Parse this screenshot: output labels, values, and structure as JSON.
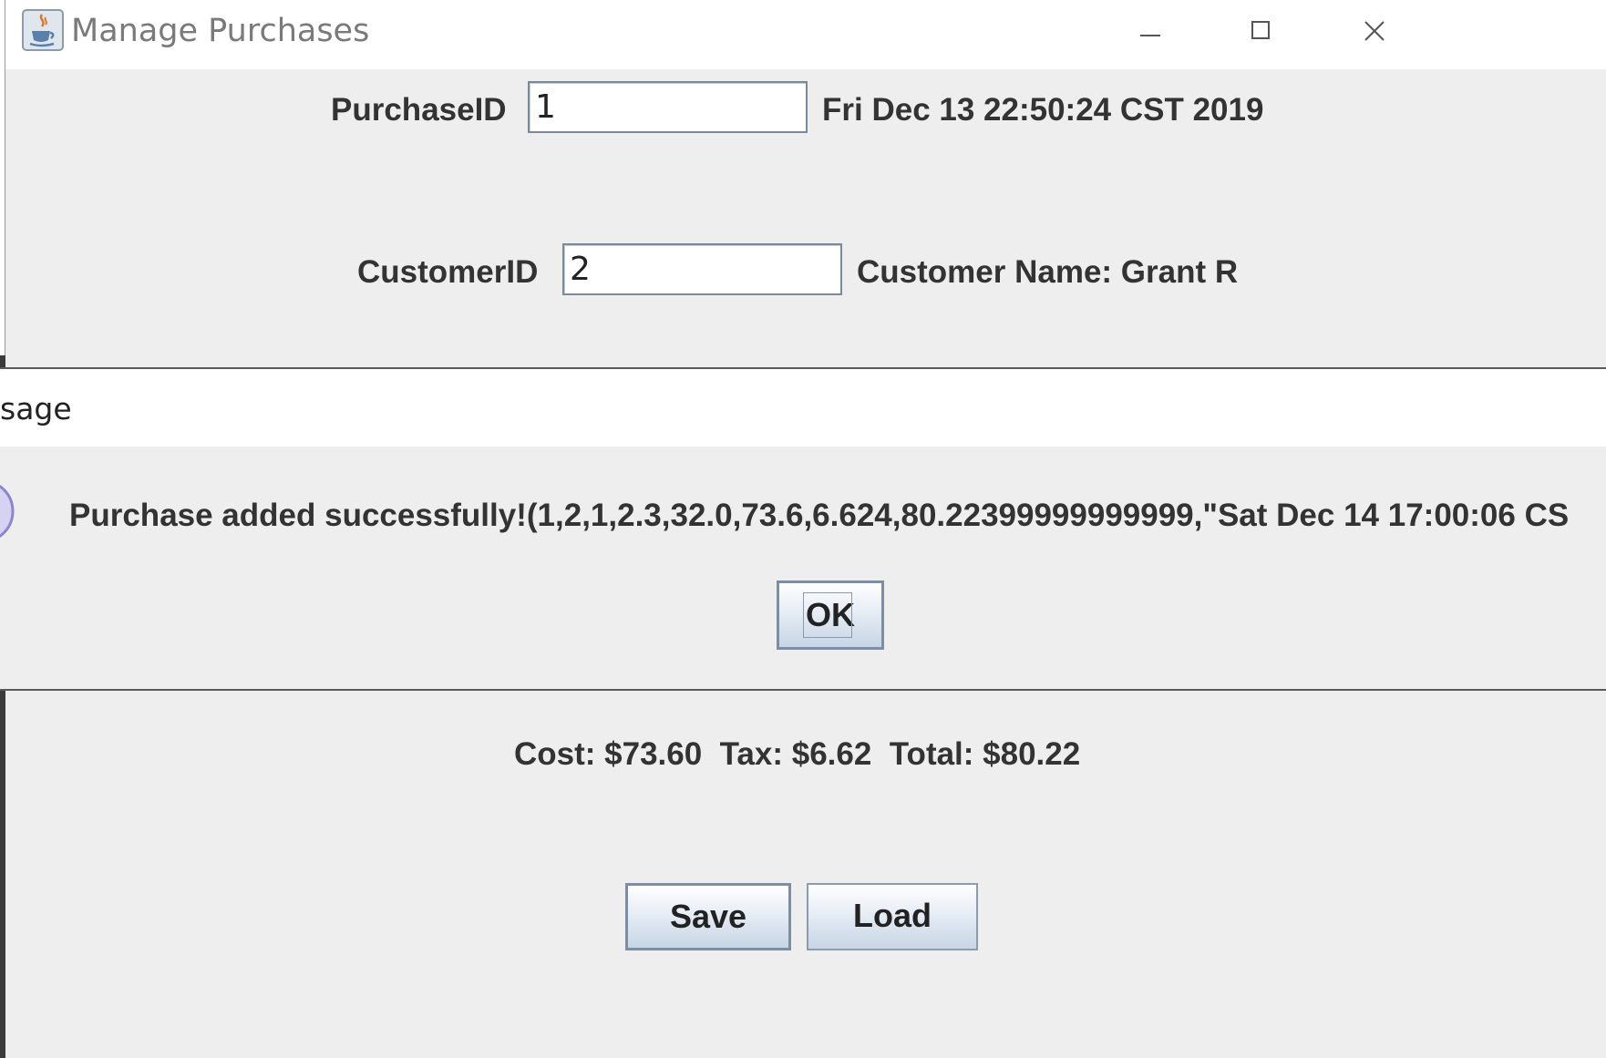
{
  "window": {
    "title": "Manage Purchases",
    "controls": [
      "minimize-icon",
      "maximize-icon",
      "close-icon"
    ]
  },
  "form": {
    "purchase_id_label": "PurchaseID",
    "purchase_id_value": "1",
    "purchase_date": "Fri Dec 13 22:50:24 CST 2019",
    "customer_id_label": "CustomerID",
    "customer_id_value": "2",
    "customer_name": "Customer Name: Grant R"
  },
  "totals": {
    "text": "Cost: $73.60  Tax: $6.62  Total: $80.22"
  },
  "buttons": {
    "save": "Save",
    "load": "Load"
  },
  "dialog": {
    "title": "sage",
    "message": "Purchase added successfully!(1,2,1,2.3,32.0,73.6,6.624,80.22399999999999,\"Sat Dec 14 17:00:06 CS",
    "ok": "OK",
    "icon": "info-icon"
  },
  "colors": {
    "background": "#eeeeee",
    "titlebar": "#ffffff",
    "button_border": "#7b8ea3"
  }
}
